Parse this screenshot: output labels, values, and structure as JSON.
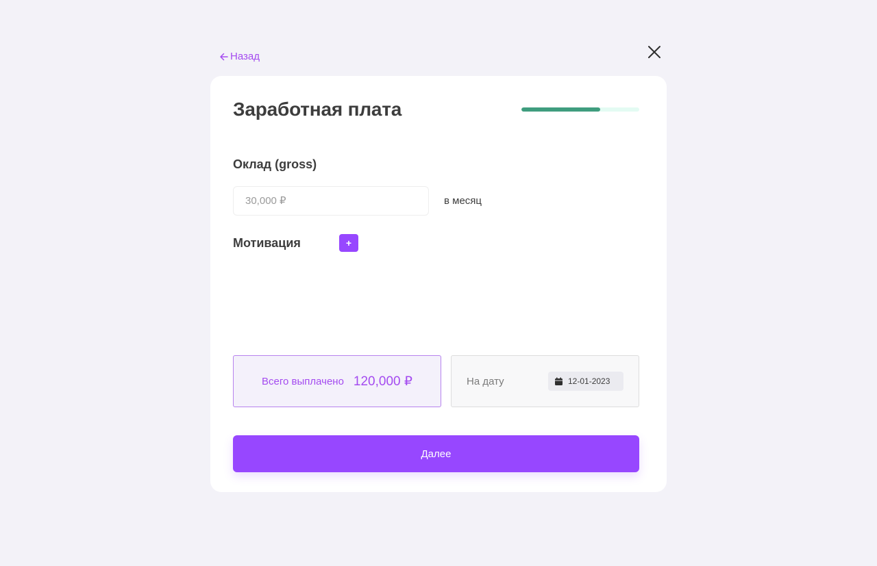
{
  "nav": {
    "back_label": "Назад"
  },
  "form": {
    "title": "Заработная плата",
    "progress_fraction": 0.67,
    "salary": {
      "label": "Оклад (gross)",
      "placeholder": "30,000 ₽",
      "value": "",
      "period": "в месяц"
    },
    "motivation": {
      "label": "Мотивация",
      "add_label": "+"
    },
    "summary": {
      "total_label": "Всего выплачено",
      "total_value": "120,000 ₽",
      "date_label": "На дату",
      "date_value": "12-01-2023"
    },
    "next_label": "Далее"
  },
  "colors": {
    "accent": "#9747ff",
    "accent_text": "#a44bf0",
    "progress": "#3f9d7e",
    "progress_track": "#e3fbf3",
    "background": "#f3f2f8"
  },
  "icons": {
    "back": "arrow-left-icon",
    "close": "close-icon",
    "date": "calendar-icon"
  }
}
